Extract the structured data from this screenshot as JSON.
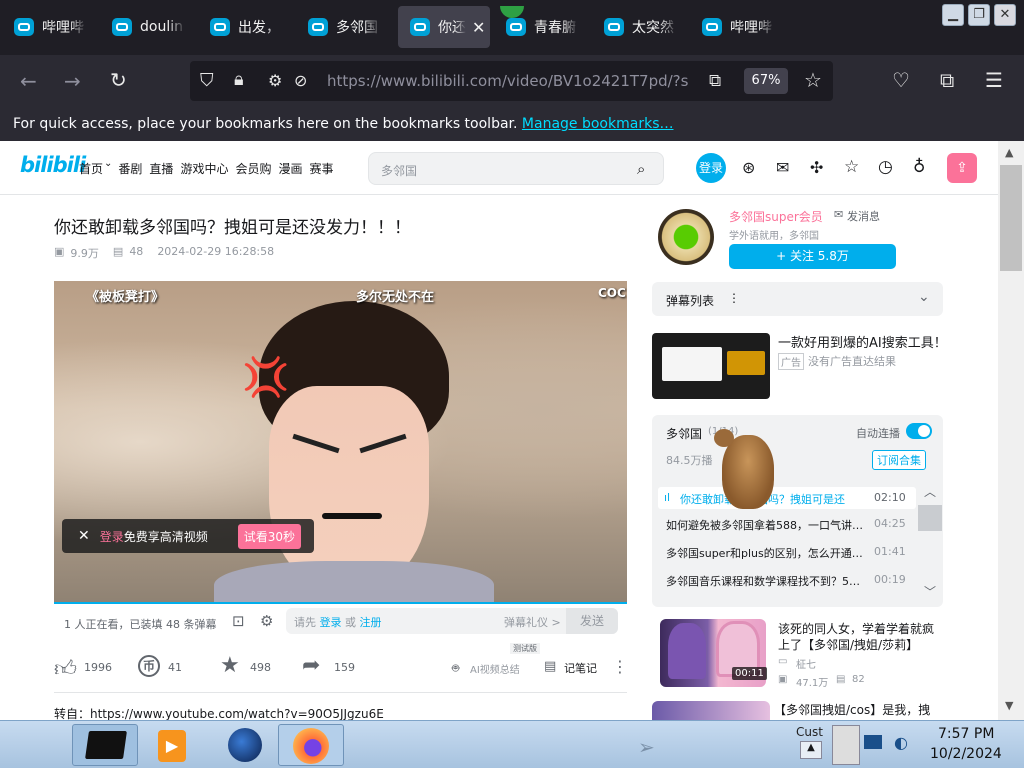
{
  "browser": {
    "tabs": [
      {
        "label": "哔哩哔"
      },
      {
        "label": "doulin"
      },
      {
        "label": "出发，"
      },
      {
        "label": "多邻国"
      },
      {
        "label": "你还",
        "active": true
      },
      {
        "label": "青春腑"
      },
      {
        "label": "太突然"
      },
      {
        "label": "哔哩哔"
      }
    ],
    "url": "https://www.bilibili.com/video/BV1o2421T7pd/?s",
    "zoom": "67%",
    "bookmarks_text": "For quick access, place your bookmarks here on the bookmarks toolbar.",
    "bookmarks_link": "Manage bookmarks…"
  },
  "site": {
    "logo": "bilibili",
    "nav": [
      "首页",
      "番剧",
      "直播",
      "游戏中心",
      "会员购",
      "漫画",
      "赛事"
    ],
    "search_placeholder": "多邻国",
    "login": "登录"
  },
  "video": {
    "title": "你还敢卸载多邻国吗？拽姐可是还没发力！！！",
    "views": "9.9万",
    "danmaku_count": "48",
    "date": "2024-02-29 16:28:58",
    "overlay_left": "《被板凳打》",
    "overlay_center": "多尔无处不在",
    "overlay_right": "COC",
    "login_tip_link": "登录",
    "login_tip": "免费享高清视频",
    "trial": "试看30秒",
    "watching": "1 人正在看，已装填 48 条弹幕",
    "danmaku_hint": "请先",
    "danmaku_login": "登录",
    "danmaku_or": "或",
    "danmaku_register": "注册",
    "danmaku_etiquette": "弹幕礼仪 >",
    "send": "发送",
    "likes": "1996",
    "coins": "41",
    "favs": "498",
    "shares": "159",
    "ai_label": "AI视频总结",
    "ai_badge": "测试版",
    "notes": "记笔记",
    "desc": "转自：https://www.youtube.com/watch?v=90O5JJgzu6E"
  },
  "uploader": {
    "name": "多邻国super会员",
    "message": "发消息",
    "bio": "学外语就用，多邻国",
    "follow": "+ 关注 5.8万"
  },
  "sidebar": {
    "danmaku_list": "弹幕列表",
    "ad_title": "一款好用到爆的AI搜索工具！",
    "ad_tag": "广告",
    "ad_sub": "没有广告直达结果",
    "playlist_title": "多邻国",
    "playlist_count": "(1/14)",
    "autoplay": "自动连播",
    "playlist_views": "84.5万播",
    "subscribe": "订阅合集",
    "items": [
      {
        "title": "你还敢卸载多邻国吗？拽姐可是还",
        "dur": "02:10",
        "active": true
      },
      {
        "title": "如何避免被多邻国拿着588，一口气讲…",
        "dur": "04:25"
      },
      {
        "title": "多邻国super和plus的区别，怎么开通…",
        "dur": "01:41"
      },
      {
        "title": "多邻国音乐课程和数学课程找不到？5…",
        "dur": "00:19"
      }
    ],
    "rec1_title": "该死的同人女，学着学着就疯上了【多邻国/拽姐/莎莉】",
    "rec1_author": "柾七",
    "rec1_views": "47.1万",
    "rec1_comments": "82",
    "rec1_dur": "00:11",
    "rec2_title": "【多邻国拽姐/cos】是我，拽"
  },
  "taskbar": {
    "time": "7:57 PM",
    "date": "10/2/2024",
    "cust": "Cust"
  },
  "colors": {
    "accent": "#00aeec",
    "pink": "#fb7299",
    "tabbar": "#1f1e25",
    "navbar": "#2b2a33"
  }
}
